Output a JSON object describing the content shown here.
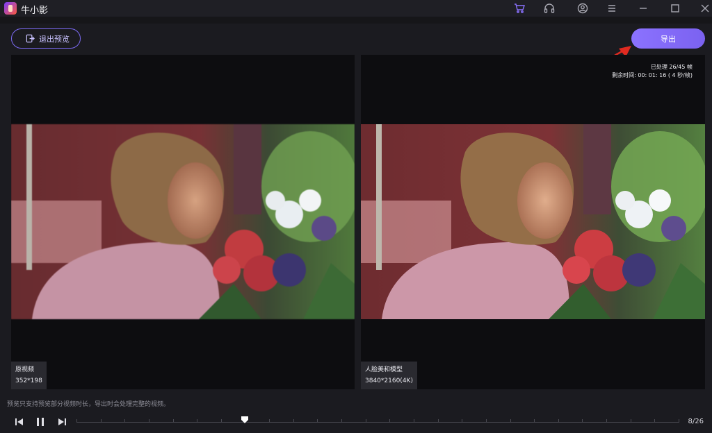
{
  "app": {
    "title": "牛小影",
    "icons": [
      "cart-icon",
      "headset-icon",
      "user-icon",
      "menu-icon",
      "minimize-icon",
      "maximize-icon",
      "close-icon"
    ]
  },
  "toolbar": {
    "exit_preview_label": "退出预览",
    "export_label": "导出"
  },
  "progress": {
    "processed_text": "已处理 26/45 帧",
    "remaining_text": "剩余时间: 00: 01: 16 ( 4 秒/帧)"
  },
  "panes": {
    "left": {
      "title": "原视频",
      "resolution": "352*198"
    },
    "right": {
      "title": "人脸美和模型",
      "resolution": "3840*2160(4K)"
    }
  },
  "notice": "预览只支持预览部分视频时长，导出时会处理完整的视频。",
  "playback": {
    "counter": "8/26",
    "current_frame": 8,
    "total_frames": 26,
    "accent_color": "#8b72ff"
  }
}
